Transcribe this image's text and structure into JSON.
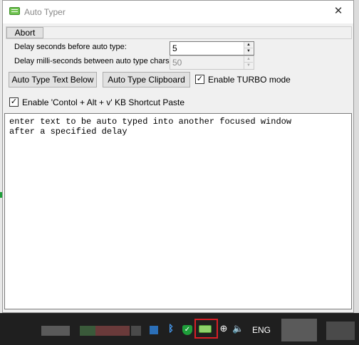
{
  "window": {
    "title": "Auto Typer",
    "close_glyph": "✕"
  },
  "toolbar": {
    "abort_label": "Abort"
  },
  "settings": {
    "delay_seconds_label": "Delay seconds before auto type:",
    "delay_seconds_value": "5",
    "delay_ms_label": "Delay milli-seconds between auto type chars:",
    "delay_ms_value": "50",
    "turbo_label": "Enable TURBO mode",
    "turbo_checked": true,
    "shortcut_label": "Enable 'Contol + Alt + v'  KB Shortcut Paste",
    "shortcut_checked": true
  },
  "actions": {
    "type_below_label": "Auto Type Text Below",
    "type_clipboard_label": "Auto Type Clipboard"
  },
  "editor": {
    "text": "enter text to be auto typed into another focused window\nafter a specified delay"
  },
  "taskbar": {
    "language": "ENG"
  },
  "colors": {
    "accent_highlight": "#d81f26",
    "window_bg": "#f0f0f0"
  }
}
